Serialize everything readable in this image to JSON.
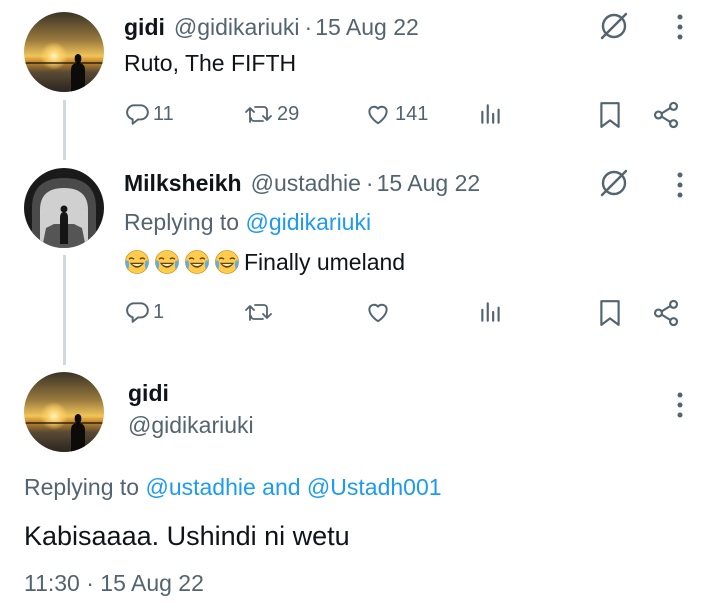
{
  "tweets": [
    {
      "name": "gidi",
      "handle": "@gidikariuki",
      "separator": "·",
      "date": "15 Aug 22",
      "text": "Ruto, The FIFTH",
      "actions": {
        "replies": "11",
        "retweets": "29",
        "likes": "141"
      }
    },
    {
      "name": "Milksheikh",
      "handle": "@ustadhie",
      "separator": "·",
      "date": "15 Aug 22",
      "replying_prefix": "Replying to",
      "replying_to": "@gidikariuki",
      "emojis": [
        "😂",
        "😂",
        "😂",
        "😂"
      ],
      "text": "Finally umeland",
      "actions": {
        "replies": "1",
        "retweets": "",
        "likes": ""
      }
    }
  ],
  "main_tweet": {
    "name": "gidi",
    "handle": "@gidikariuki",
    "replying_prefix": "Replying to",
    "replying_to": "@ustadhie and @Ustadh001",
    "text": "Kabisaaaa. Ushindi ni wetu",
    "timestamp": "11:30 · 15 Aug 22"
  },
  "icons": {
    "grok": "grok-icon",
    "more": "more-icon",
    "reply": "reply-icon",
    "retweet": "retweet-icon",
    "like": "like-icon",
    "views": "views-icon",
    "bookmark": "bookmark-icon",
    "share": "share-icon"
  },
  "colors": {
    "text": "#0f1419",
    "secondary": "#536471",
    "link": "#1d9bf0",
    "thread_line": "#cfd9de"
  }
}
